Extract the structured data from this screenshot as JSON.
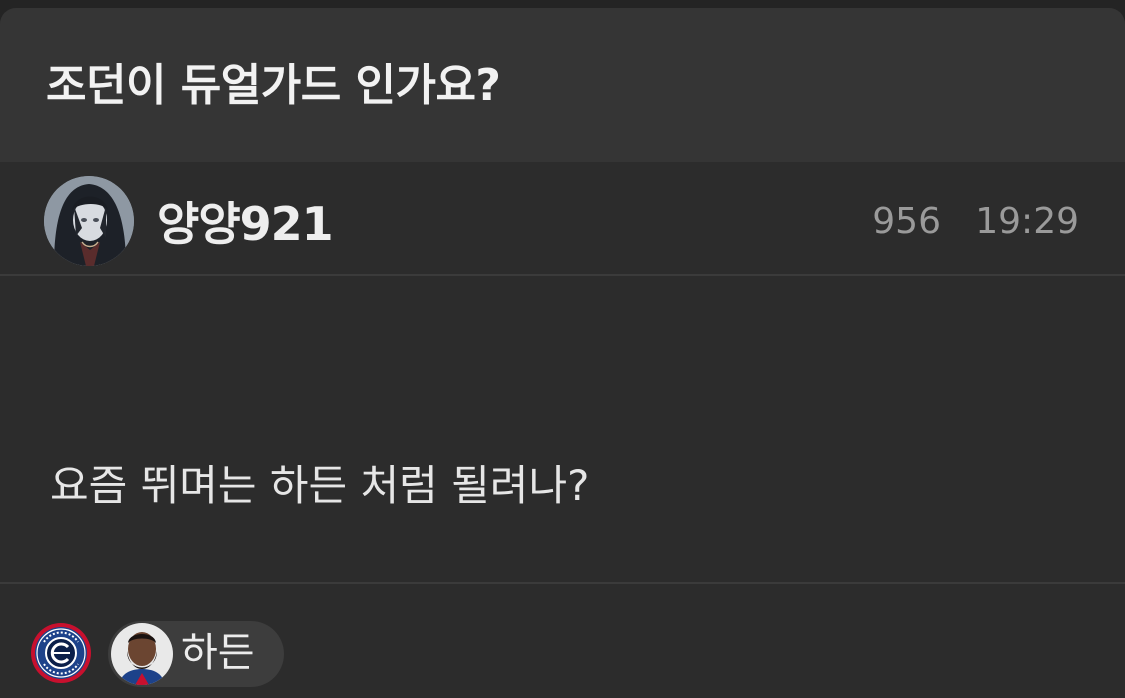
{
  "post": {
    "title": "조던이 듀얼가드 인가요?",
    "body": "요즘 뛰며는 하든 처럼 될려나?"
  },
  "author": {
    "name": "양양921",
    "avatar_icon": "anime-avatar-icon"
  },
  "meta": {
    "views": "956",
    "time": "19:29"
  },
  "tags": [
    {
      "team_icon": "clippers-logo-icon"
    },
    {
      "label": "하든",
      "avatar_icon": "player-avatar-icon"
    }
  ],
  "colors": {
    "background": "#2c2c2c",
    "title_bar": "#353535",
    "muted_text": "#9a9a9a",
    "chip": "#3d3d3d"
  }
}
